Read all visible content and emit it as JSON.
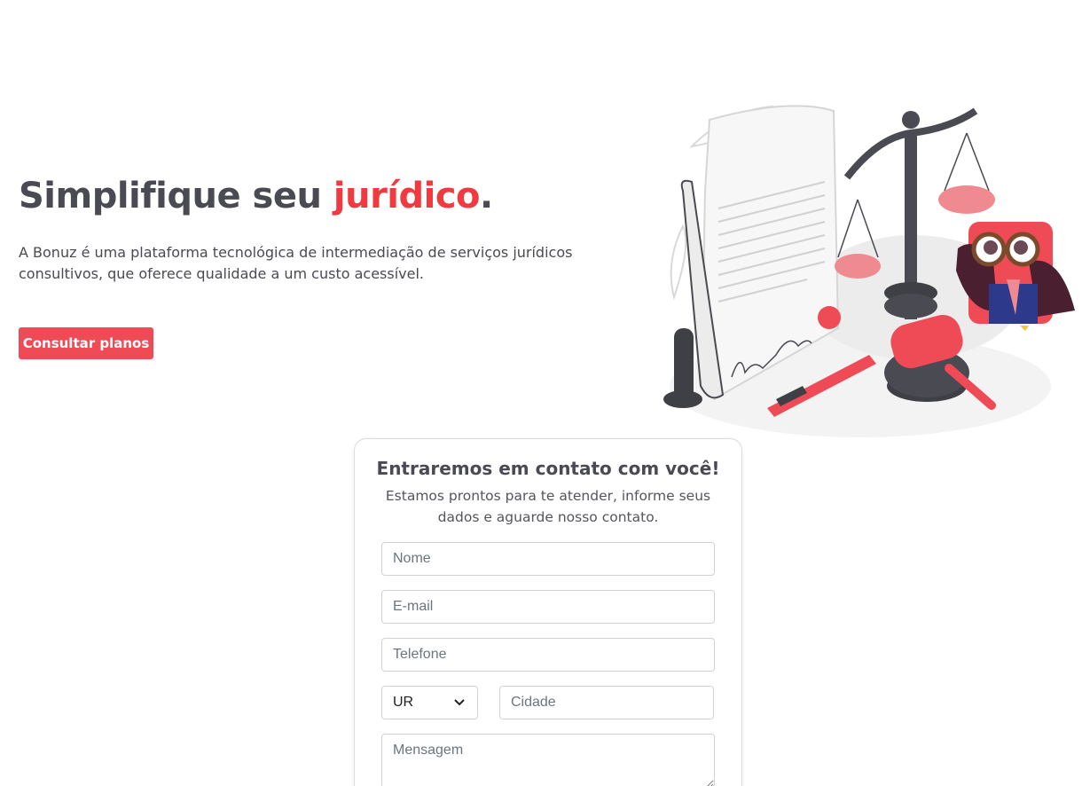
{
  "hero": {
    "title_main": "Simplifique seu ",
    "title_accent": "jurídico",
    "title_end": ".",
    "subtitle": "A Bonuz é uma plataforma tecnológica de intermediação de serviços jurídicos consultivos, que oferece qualidade a um custo acessível.",
    "cta_label": "Consultar planos"
  },
  "colors": {
    "accent": "#ef3a3f",
    "button": "#ee4b57",
    "text": "#4a4a52"
  },
  "illustration": {
    "icon": "legal-illustration-scale-gavel-document-owl"
  },
  "contact_form": {
    "title": "Entraremos em contato com você!",
    "subtitle": "Estamos prontos para te atender, informe seus dados e aguarde nosso contato.",
    "name_placeholder": "Nome",
    "email_placeholder": "E-mail",
    "phone_placeholder": "Telefone",
    "state_selected": "UR",
    "city_placeholder": "Cidade",
    "message_placeholder": "Mensagem"
  }
}
